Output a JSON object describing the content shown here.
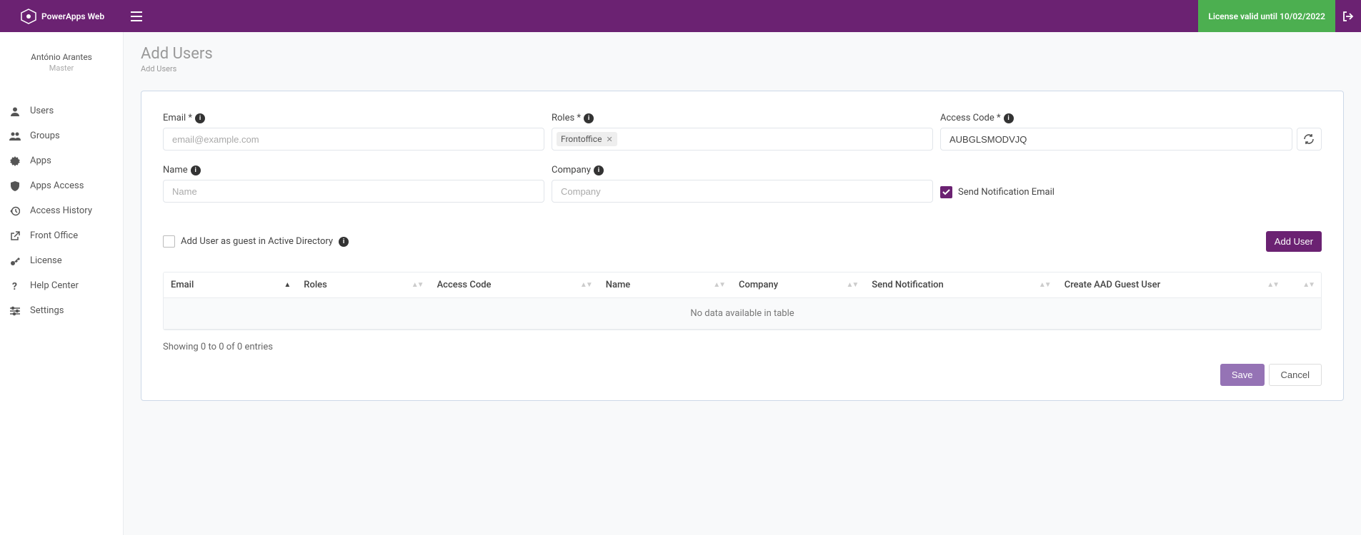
{
  "header": {
    "brand": "PowerApps Web",
    "license_text": "License valid until 10/02/2022"
  },
  "user": {
    "name": "António Arantes",
    "role": "Master"
  },
  "sidebar": {
    "items": [
      {
        "label": "Users"
      },
      {
        "label": "Groups"
      },
      {
        "label": "Apps"
      },
      {
        "label": "Apps Access"
      },
      {
        "label": "Access History"
      },
      {
        "label": "Front Office"
      },
      {
        "label": "License"
      },
      {
        "label": "Help Center"
      },
      {
        "label": "Settings"
      }
    ]
  },
  "page": {
    "title": "Add Users",
    "breadcrumb": "Add Users"
  },
  "form": {
    "email": {
      "label": "Email *",
      "placeholder": "email@example.com"
    },
    "roles": {
      "label": "Roles *",
      "tag": "Frontoffice"
    },
    "access": {
      "label": "Access Code *",
      "value": "AUBGLSMODVJQ"
    },
    "name": {
      "label": "Name",
      "placeholder": "Name"
    },
    "company": {
      "label": "Company",
      "placeholder": "Company"
    },
    "notify": {
      "label": "Send Notification Email"
    },
    "aad": {
      "label": "Add User as guest in Active Directory"
    },
    "add_button": "Add User"
  },
  "table": {
    "headers": [
      "Email",
      "Roles",
      "Access Code",
      "Name",
      "Company",
      "Send Notification",
      "Create AAD Guest User",
      ""
    ],
    "empty": "No data available in table",
    "info": "Showing 0 to 0 of 0 entries"
  },
  "buttons": {
    "save": "Save",
    "cancel": "Cancel"
  }
}
